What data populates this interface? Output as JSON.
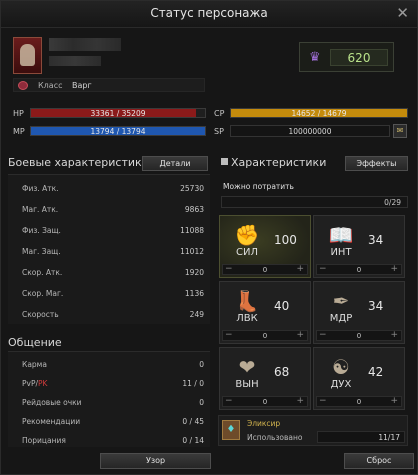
{
  "window": {
    "title": "Статус персонажа",
    "close_glyph": "✕"
  },
  "character": {
    "class_label": "Класс",
    "class_value": "Варг",
    "power": "620"
  },
  "bars": {
    "hp": {
      "label": "HP",
      "text": "33361 / 35209",
      "fraction": 0.9475,
      "color": "#8b1a1a"
    },
    "mp": {
      "label": "MP",
      "text": "13794 / 13794",
      "fraction": 1.0,
      "color": "#1f57b0"
    },
    "cp": {
      "label": "CP",
      "text": "14652 / 14679",
      "fraction": 0.998,
      "color": "#c48b0c"
    },
    "sp": {
      "label": "SP",
      "text": "100000000"
    }
  },
  "combat": {
    "title": "Боевые характеристики",
    "details_button": "Детали",
    "rows": [
      {
        "k": "Физ. Атк.",
        "v": "25730"
      },
      {
        "k": "Маг. Атк.",
        "v": "9863"
      },
      {
        "k": "Физ. Защ.",
        "v": "11088"
      },
      {
        "k": "Маг. Защ.",
        "v": "11012"
      },
      {
        "k": "Скор. Атк.",
        "v": "1920"
      },
      {
        "k": "Скор. Маг.",
        "v": "1136"
      },
      {
        "k": "Скорость",
        "v": "249"
      }
    ]
  },
  "social": {
    "title": "Общение",
    "rows": [
      {
        "k": "Карма",
        "v": "0"
      },
      {
        "k": "PvP",
        "k2": "/",
        "k3": "PK",
        "v": "11 / 0"
      },
      {
        "k": "Рейдовые очки",
        "v": "0"
      },
      {
        "k": "Рекомендации",
        "v": "0 / 45"
      },
      {
        "k": "Порицания",
        "v": "0 / 14"
      }
    ]
  },
  "stats": {
    "title": "Характеристики",
    "effects_button": "Эффекты",
    "spend_label": "Можно потратить",
    "spend_value": "0/29",
    "items": [
      {
        "name": "СИЛ",
        "value": "100",
        "bonus": "0",
        "icon": "fist-icon",
        "glyph": "✊"
      },
      {
        "name": "ИНТ",
        "value": "34",
        "bonus": "0",
        "icon": "book-icon",
        "glyph": "📖"
      },
      {
        "name": "ЛВК",
        "value": "40",
        "bonus": "0",
        "icon": "boot-icon",
        "glyph": "👢"
      },
      {
        "name": "МДР",
        "value": "34",
        "bonus": "0",
        "icon": "quill-icon",
        "glyph": "✒"
      },
      {
        "name": "ВЫН",
        "value": "68",
        "bonus": "0",
        "icon": "heart-icon",
        "glyph": "❤"
      },
      {
        "name": "ДУХ",
        "value": "42",
        "bonus": "0",
        "icon": "spirit-icon",
        "glyph": "☯"
      }
    ],
    "minus": "−",
    "plus": "+"
  },
  "elixir": {
    "name": "Эликсир",
    "used_label": "Использовано",
    "used_value": "11/17"
  },
  "footer": {
    "pattern_button": "Узор",
    "reset_button": "Сброс"
  }
}
